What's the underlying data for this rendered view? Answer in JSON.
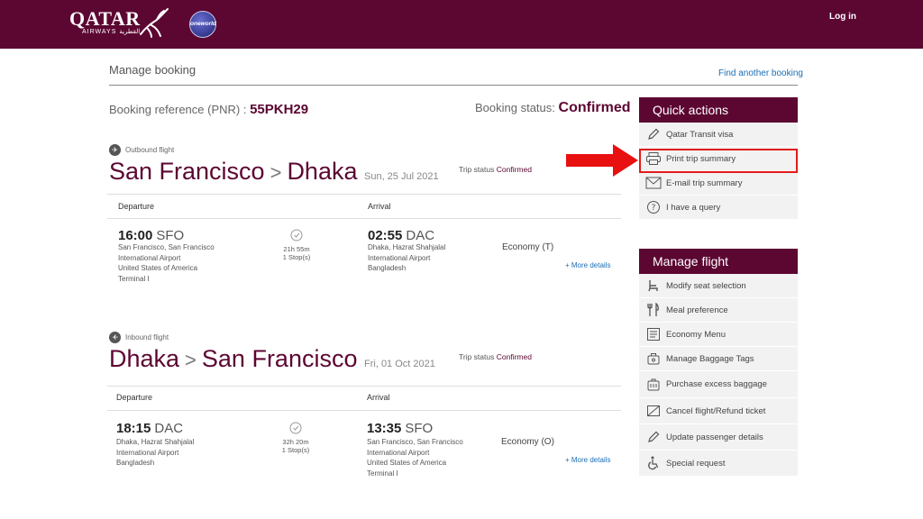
{
  "header": {
    "logo_main": "QATAR",
    "logo_sub": "AIRWAYS القطرية",
    "oneworld": "oneworld",
    "login": "Log in"
  },
  "page": {
    "title": "Manage booking",
    "find_another": "Find another booking",
    "pnr_label": "Booking reference (PNR) :",
    "pnr_value": "55PKH29",
    "status_label": "Booking status:",
    "status_value": "Confirmed"
  },
  "flights": [
    {
      "label": "Outbound flight",
      "from": "San Francisco",
      "to": "Dhaka",
      "date": "Sun, 25 Jul 2021",
      "trip_status_label": "Trip status",
      "trip_status_value": "Confirmed",
      "departure_head": "Departure",
      "arrival_head": "Arrival",
      "dep_time": "16:00",
      "dep_code": "SFO",
      "dep_address": [
        "San Francisco, San Francisco",
        "International Airport",
        "United States of America",
        "Terminal I"
      ],
      "duration": "21h 55m",
      "stops": "1 Stop(s)",
      "arr_time": "02:55",
      "arr_code": "DAC",
      "arr_address": [
        "Dhaka, Hazrat Shahjalal",
        "International Airport",
        "Bangladesh"
      ],
      "cabin": "Economy (T)",
      "more": "+ More details"
    },
    {
      "label": "Inbound flight",
      "from": "Dhaka",
      "to": "San Francisco",
      "date": "Fri, 01 Oct 2021",
      "trip_status_label": "Trip status",
      "trip_status_value": "Confirmed",
      "departure_head": "Departure",
      "arrival_head": "Arrival",
      "dep_time": "18:15",
      "dep_code": "DAC",
      "dep_address": [
        "Dhaka, Hazrat Shahjalal",
        "International Airport",
        "Bangladesh"
      ],
      "duration": "32h 20m",
      "stops": "1 Stop(s)",
      "arr_time": "13:35",
      "arr_code": "SFO",
      "arr_address": [
        "San Francisco, San Francisco",
        "International Airport",
        "United States of America",
        "Terminal I"
      ],
      "cabin": "Economy (O)",
      "more": "+ More details"
    }
  ],
  "quick_actions": {
    "title": "Quick actions",
    "items": [
      {
        "label": "Qatar Transit visa",
        "icon": "pencil-icon"
      },
      {
        "label": "Print trip summary",
        "icon": "printer-icon"
      },
      {
        "label": "E-mail trip summary",
        "icon": "envelope-icon"
      },
      {
        "label": "I have a query",
        "icon": "question-icon"
      }
    ]
  },
  "manage_flight": {
    "title": "Manage flight",
    "items": [
      {
        "label": "Modify seat selection",
        "icon": "seat-icon"
      },
      {
        "label": "Meal preference",
        "icon": "cutlery-icon"
      },
      {
        "label": "Economy Menu",
        "icon": "menu-icon"
      },
      {
        "label": "Manage Baggage Tags",
        "icon": "baggage-tag-icon"
      },
      {
        "label": "Purchase excess baggage",
        "icon": "suitcase-icon"
      },
      {
        "label": "Cancel flight/Refund ticket",
        "icon": "cancel-ticket-icon"
      },
      {
        "label": "Update passenger details",
        "icon": "pencil-icon"
      },
      {
        "label": "Special request",
        "icon": "wheelchair-icon"
      }
    ]
  },
  "colors": {
    "brand": "#5c0632",
    "link": "#1a6fb5",
    "highlight": "#e31b1b"
  }
}
